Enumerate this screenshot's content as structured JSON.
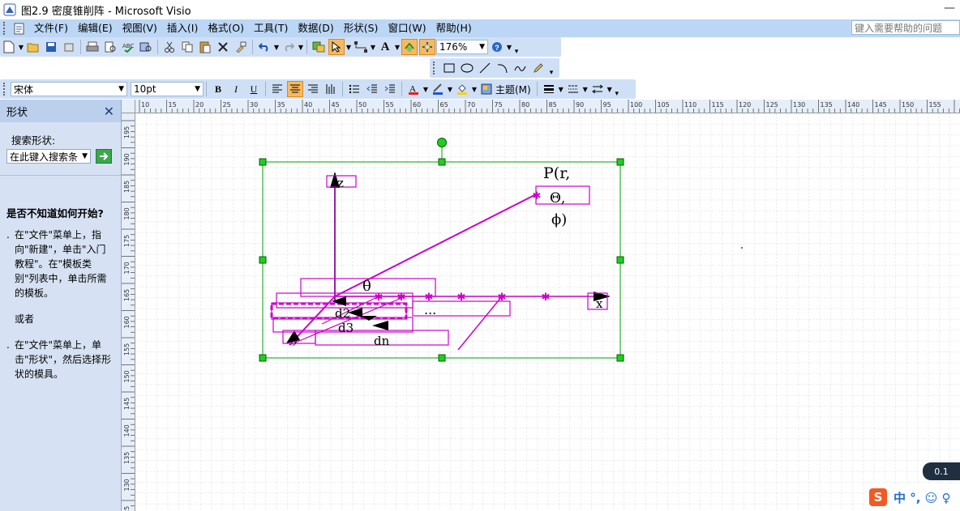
{
  "window": {
    "title": "图2.9 密度锥削阵 - Microsoft Visio",
    "minimize": "—"
  },
  "menu": [
    "文件(F)",
    "编辑(E)",
    "视图(V)",
    "插入(I)",
    "格式(O)",
    "工具(T)",
    "数据(D)",
    "形状(S)",
    "窗口(W)",
    "帮助(H)"
  ],
  "help_search": {
    "placeholder": "键入需要帮助的问题"
  },
  "toolbar": {
    "zoom": "176%"
  },
  "format": {
    "font": "宋体",
    "size": "10pt",
    "bold": "B",
    "italic": "I",
    "underline": "U",
    "theme": "主题(M)"
  },
  "shapes_panel": {
    "title": "形状",
    "search_label": "搜索形状:",
    "search_placeholder": "在此键入搜索条",
    "help_heading": "是否不知道如何开始?",
    "tip1": "在\"文件\"菜单上，指向\"新建\"，单击\"入门教程\"。在\"模板类别\"列表中，单击所需的模板。",
    "or": "或者",
    "tip2": "在\"文件\"菜单上，单击\"形状\"，然后选择形状的模具。"
  },
  "ruler": {
    "top": [
      "10",
      "15",
      "20",
      "25",
      "30",
      "35",
      "40",
      "45",
      "50",
      "55",
      "60",
      "65",
      "70",
      "75",
      "80",
      "85",
      "90",
      "95",
      "100",
      "105",
      "110",
      "115",
      "120",
      "125",
      "130",
      "135",
      "140",
      "145",
      "150",
      "155"
    ],
    "left": [
      "195",
      "190",
      "185",
      "180",
      "175",
      "170",
      "165",
      "160",
      "155",
      "150",
      "145",
      "140",
      "135",
      "130",
      "125"
    ]
  },
  "drawing": {
    "z": "z",
    "x": "x",
    "p1": "P(r,",
    "p2": "Θ,",
    "p3": "ϕ)",
    "theta": "θ",
    "d2": "d2",
    "d3": "d3",
    "dn": "dn",
    "dots": "...",
    "y": "y"
  },
  "colors": {
    "accent": "#cc00cc",
    "line": "#9a1fa8",
    "selection": "#00a000",
    "handle": "#22cc22"
  },
  "ime": {
    "logo": "S",
    "text": "中 °, ☺ ♀"
  },
  "zoom_hint": "0.1"
}
